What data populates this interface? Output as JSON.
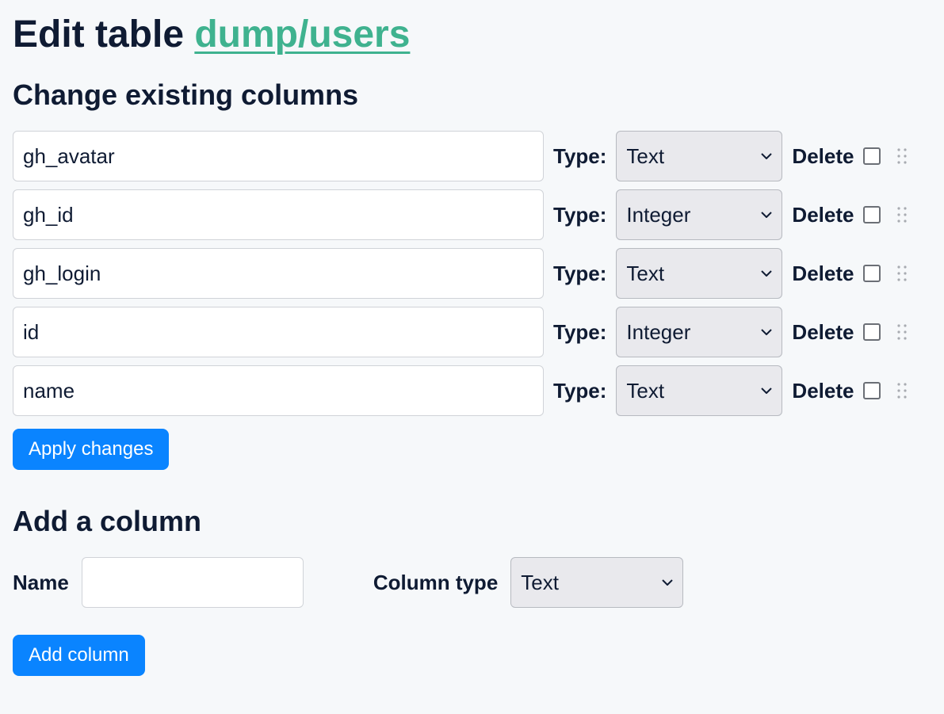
{
  "header": {
    "title_prefix": "Edit table ",
    "title_link": "dump/users"
  },
  "change_columns": {
    "heading": "Change existing columns",
    "type_label": "Type:",
    "delete_label": "Delete",
    "type_options": [
      "Text",
      "Integer"
    ],
    "columns": [
      {
        "name": "gh_avatar",
        "type": "Text"
      },
      {
        "name": "gh_id",
        "type": "Integer"
      },
      {
        "name": "gh_login",
        "type": "Text"
      },
      {
        "name": "id",
        "type": "Integer"
      },
      {
        "name": "name",
        "type": "Text"
      }
    ],
    "apply_button": "Apply changes"
  },
  "add_column": {
    "heading": "Add a column",
    "name_label": "Name",
    "name_value": "",
    "type_label": "Column type",
    "type_value": "Text",
    "type_options": [
      "Text",
      "Integer"
    ],
    "add_button": "Add column"
  }
}
